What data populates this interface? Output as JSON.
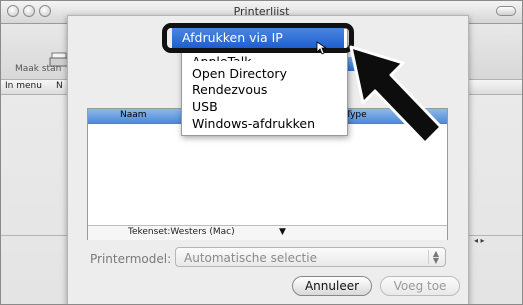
{
  "window": {
    "title": "Printerlijst",
    "toolbar_label": "Maak stan",
    "column_header_1": "In menu",
    "column_header_2": "N"
  },
  "dialog": {
    "list_header_name": "Naam",
    "list_header_type": "Type",
    "encoding_label": "Tekenset:Westers (Mac)",
    "printer_model_label": "Printermodel:",
    "printer_model_value": "Automatische selectie",
    "cancel_button": "Annuleer",
    "add_button": "Voeg toe"
  },
  "popup_menu": {
    "items": [
      {
        "label": "Afdrukken via IP",
        "selected": true
      },
      {
        "label": "AppleTalk",
        "selected": false
      },
      {
        "label": "Open Directory",
        "selected": false
      },
      {
        "label": "Rendezvous",
        "selected": false
      },
      {
        "label": "USB",
        "selected": false
      },
      {
        "label": "Windows-afdrukken",
        "selected": false
      }
    ]
  },
  "colors": {
    "highlight": "#1e5fcf",
    "annotation": "#111111"
  },
  "icons": {
    "close": "traffic-light-icon",
    "annotation_arrow": "pointer-arrow-icon",
    "cursor": "mouse-cursor-icon"
  }
}
